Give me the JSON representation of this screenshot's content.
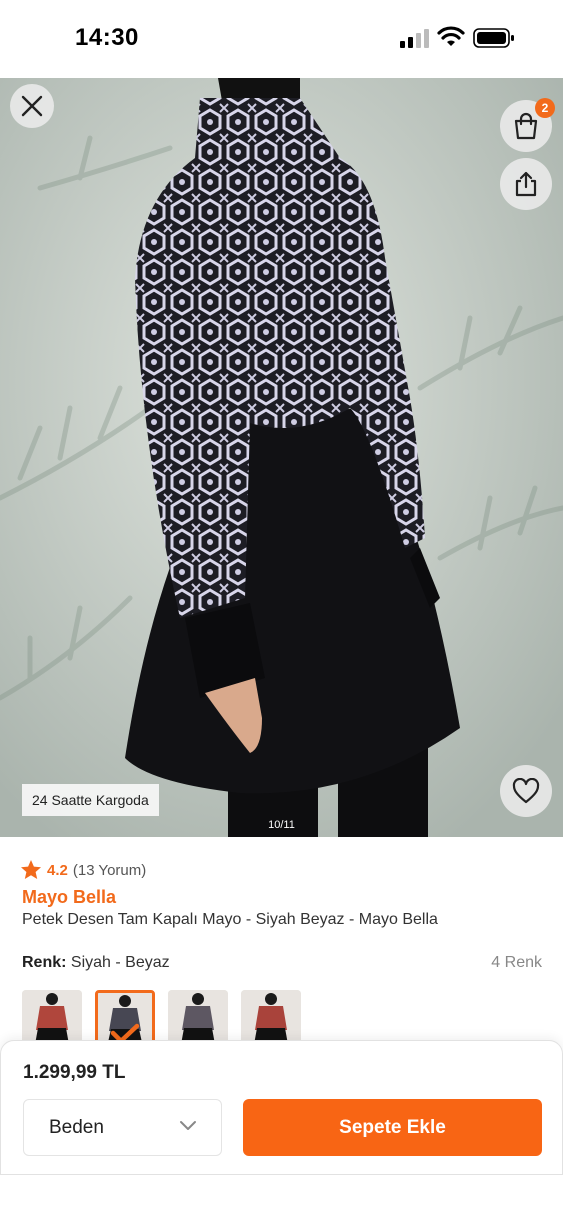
{
  "status_bar": {
    "time": "14:30"
  },
  "hero": {
    "cart_count": "2",
    "shipping_tag": "24 Saatte Kargoda",
    "image_counter": "10/11"
  },
  "product": {
    "rating": "4.2",
    "review_count": "(13 Yorum)",
    "brand": "Mayo Bella",
    "title": "Petek Desen Tam Kapalı Mayo - Siyah Beyaz - Mayo Bella",
    "color_label": "Renk:",
    "color_value": "Siyah - Beyaz",
    "color_count": "4 Renk",
    "color_options_count": 4,
    "selected_color_index": 1
  },
  "buy_panel": {
    "price": "1.299,99 TL",
    "size_placeholder": "Beden",
    "add_to_cart_label": "Sepete Ekle"
  },
  "colors": {
    "accent": "#f26a1b",
    "button": "#f86514"
  },
  "icons": [
    "close-icon",
    "shopping-bag-icon",
    "share-icon",
    "heart-icon",
    "star-icon",
    "chevron-down-icon",
    "checkmark-icon"
  ]
}
